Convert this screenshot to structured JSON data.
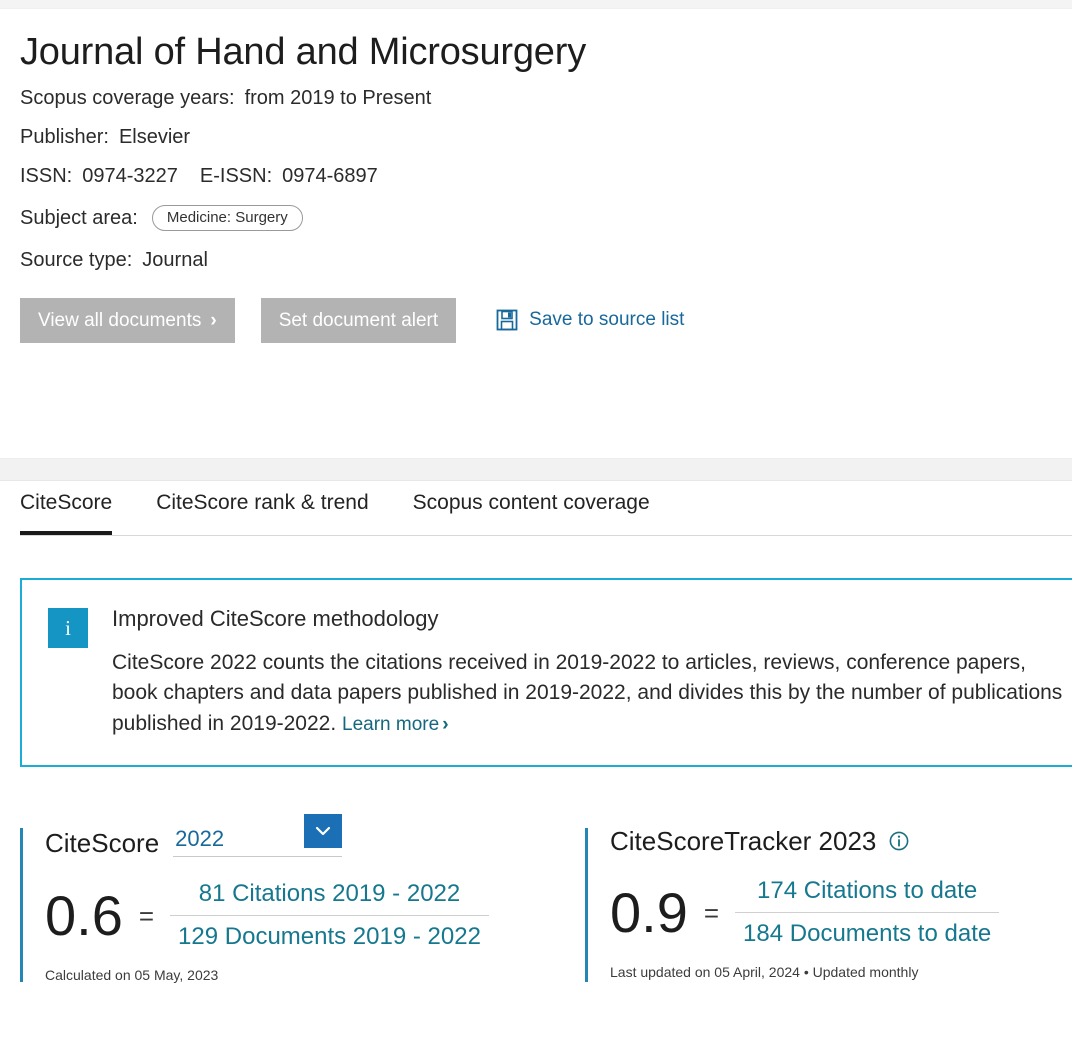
{
  "header": {
    "title": "Journal of Hand and Microsurgery",
    "coverage_label": "Scopus coverage years:",
    "coverage_value": "from 2019 to Present",
    "publisher_label": "Publisher:",
    "publisher_value": "Elsevier",
    "issn_label": "ISSN:",
    "issn_value": "0974-3227",
    "eissn_label": "E-ISSN:",
    "eissn_value": "0974-6897",
    "subject_label": "Subject area:",
    "subject_chip": "Medicine: Surgery",
    "source_type_label": "Source type:",
    "source_type_value": "Journal"
  },
  "actions": {
    "view_all_documents": "View all documents",
    "view_all_chevron": "›",
    "set_document_alert": "Set document alert",
    "save_to_source_list": "Save to source list",
    "save_icon": "save-floppy-icon"
  },
  "tabs": [
    {
      "label": "CiteScore",
      "active": true
    },
    {
      "label": "CiteScore rank & trend",
      "active": false
    },
    {
      "label": "Scopus content coverage",
      "active": false
    }
  ],
  "banner": {
    "icon": "info-icon",
    "icon_glyph": "i",
    "title": "Improved CiteScore methodology",
    "text": "CiteScore 2022 counts the citations received in 2019-2022 to articles, reviews, conference papers, book chapters and data papers published in 2019-2022, and divides this by the number of publications published in 2019-2022. ",
    "learn_more": "Learn more",
    "learn_more_chevron": "›"
  },
  "citescore_panel": {
    "title": "CiteScore",
    "year": "2022",
    "dropdown_icon": "chevron-down-icon",
    "score": "0.6",
    "equals": "=",
    "numerator": "81 Citations 2019 - 2022",
    "denominator": "129 Documents 2019 - 2022",
    "note": "Calculated on 05 May, 2023"
  },
  "tracker_panel": {
    "title": "CiteScoreTracker 2023",
    "info_icon": "info-circle-icon",
    "score": "0.9",
    "equals": "=",
    "numerator": "174 Citations to date",
    "denominator": "184 Documents to date",
    "note": "Last updated on 05 April, 2024 • Updated monthly"
  },
  "colors": {
    "accent_teal": "#16788f",
    "accent_blue": "#1a6fb5",
    "banner_border": "#1badd6",
    "info_square": "#1595c4",
    "button_grey": "#b3b3b3",
    "tab_active_underline": "#1a1a1a"
  }
}
